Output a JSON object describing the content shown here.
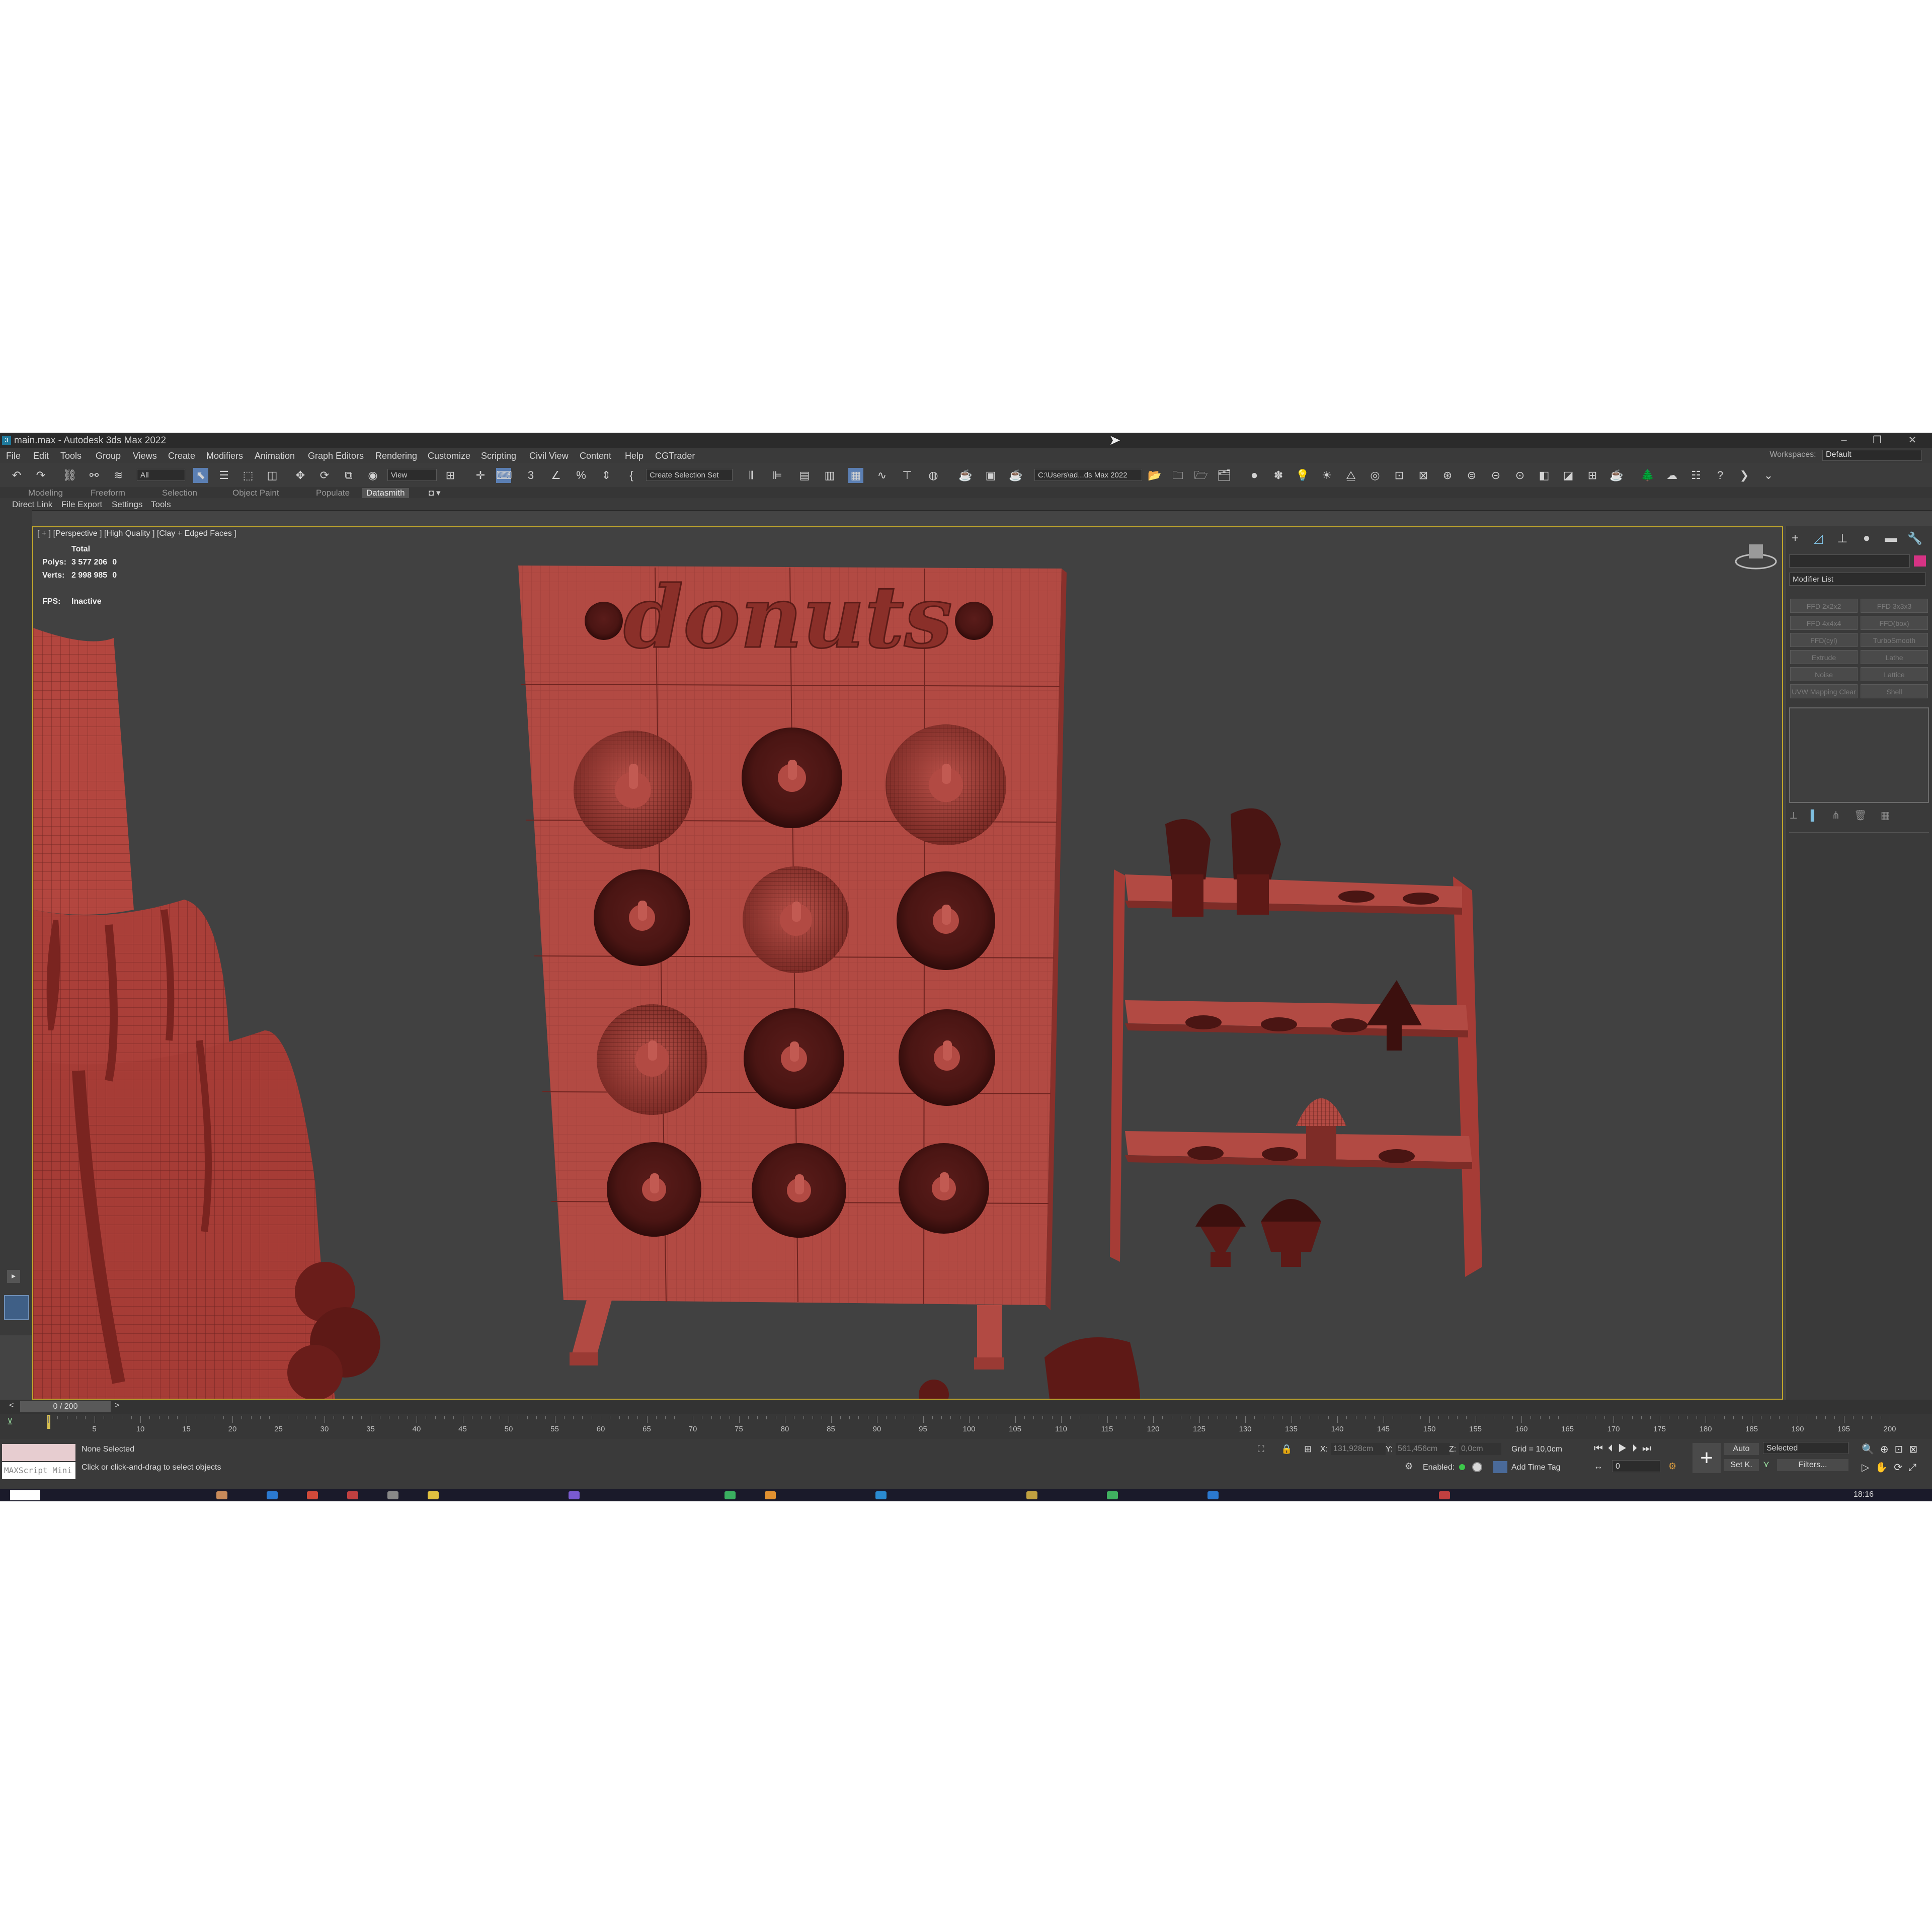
{
  "window": {
    "title": "main.max - Autodesk 3ds Max 2022",
    "app_icon_glyph": "3"
  },
  "menu": [
    "File",
    "Edit",
    "Tools",
    "Group",
    "Views",
    "Create",
    "Modifiers",
    "Animation",
    "Graph Editors",
    "Rendering",
    "Customize",
    "Scripting",
    "Civil View",
    "Content",
    "Help",
    "CGTrader"
  ],
  "workspaces": {
    "label": "Workspaces:",
    "value": "Default"
  },
  "toolbar": {
    "filter_dropdown": "All",
    "ref_coord_dropdown": "View",
    "selection_set_dropdown": "Create Selection Set",
    "project_path": "C:\\Users\\ad...ds Max 2022"
  },
  "ribbon_tabs": [
    "Modeling",
    "Freeform",
    "Selection",
    "Object Paint",
    "Populate",
    "Datasmith"
  ],
  "ribbon_selected": "Datasmith",
  "ribbon_subtabs": [
    "Direct Link",
    "File Export",
    "Settings",
    "Tools"
  ],
  "viewport": {
    "label": "[ + ] [Perspective ] [High Quality ] [Clay + Edged Faces ]",
    "stats_header": "Total",
    "polys_label": "Polys:",
    "polys_value": "3 577 206",
    "polys_sel": "0",
    "verts_label": "Verts:",
    "verts_value": "2 998 985",
    "verts_sel": "0",
    "fps_label": "FPS:",
    "fps_value": "Inactive",
    "board_text": "donuts"
  },
  "command_panel": {
    "modifier_list": "Modifier List",
    "modifier_buttons": [
      "FFD 2x2x2",
      "FFD 3x3x3",
      "FFD 4x4x4",
      "FFD(box)",
      "FFD(cyl)",
      "TurboSmooth",
      "Extrude",
      "Lathe",
      "Noise",
      "Lattice",
      "UVW Mapping Clear",
      "Shell"
    ],
    "color_swatch": "#d63384"
  },
  "timeline": {
    "frame_display": "0 / 200",
    "prev": "<",
    "next": ">",
    "ticks": [
      "0",
      "5",
      "10",
      "15",
      "20",
      "25",
      "30",
      "35",
      "40",
      "45",
      "50",
      "55",
      "60",
      "65",
      "70",
      "75",
      "80",
      "85",
      "90",
      "95",
      "100",
      "105",
      "110",
      "115",
      "120",
      "125",
      "130",
      "135",
      "140",
      "145",
      "150",
      "155",
      "160",
      "165",
      "170",
      "175",
      "180",
      "185",
      "190",
      "195",
      "200"
    ]
  },
  "status": {
    "maxscript_label": "MAXScript Mini",
    "selection": "None Selected",
    "prompt": "Click or click-and-drag to select objects",
    "x_label": "X:",
    "x_value": "131,928cm",
    "y_label": "Y:",
    "y_value": "561,456cm",
    "z_label": "Z:",
    "z_value": "0,0cm",
    "grid": "Grid = 10,0cm",
    "enabled": "Enabled:",
    "add_time_tag": "Add Time Tag",
    "auto_key": "Auto",
    "set_key": "Set K.",
    "key_filter_dropdown": "Selected",
    "filters": "Filters...",
    "frame_field": "0",
    "clock": "18:16"
  }
}
